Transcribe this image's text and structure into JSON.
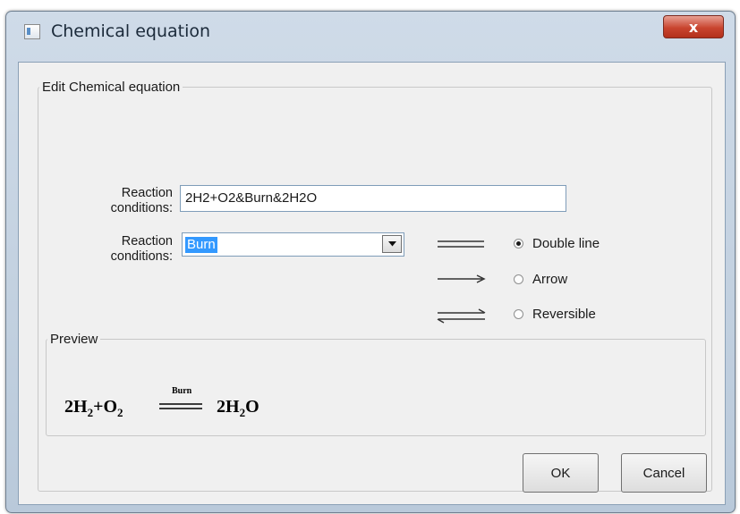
{
  "window": {
    "title": "Chemical equation",
    "close_glyph": "x"
  },
  "edit_group": {
    "legend": "Edit Chemical equation",
    "equation_label_line1": "Reaction",
    "equation_label_line2": "conditions:",
    "equation_value": "2H2+O2&Burn&2H2O",
    "condition_label_line1": "Reaction",
    "condition_label_line2": "conditions:",
    "condition_value": "Burn"
  },
  "arrow_options": [
    {
      "label": "Double line",
      "checked": true,
      "icon": "double-line-icon"
    },
    {
      "label": "Arrow",
      "checked": false,
      "icon": "arrow-icon"
    },
    {
      "label": "Reversible",
      "checked": false,
      "icon": "reversible-arrow-icon"
    }
  ],
  "preview": {
    "legend": "Preview",
    "reactant_1": "2H",
    "reactant_1_sub": "2",
    "plus": "+O",
    "reactant_2_sub": "2",
    "condition": "Burn",
    "product": "2H",
    "product_sub": "2",
    "product_tail": "O"
  },
  "buttons": {
    "ok": "OK",
    "cancel": "Cancel"
  },
  "colors": {
    "selection": "#3399ff",
    "close_button": "#c9452f",
    "frame": "#b9c9da"
  }
}
